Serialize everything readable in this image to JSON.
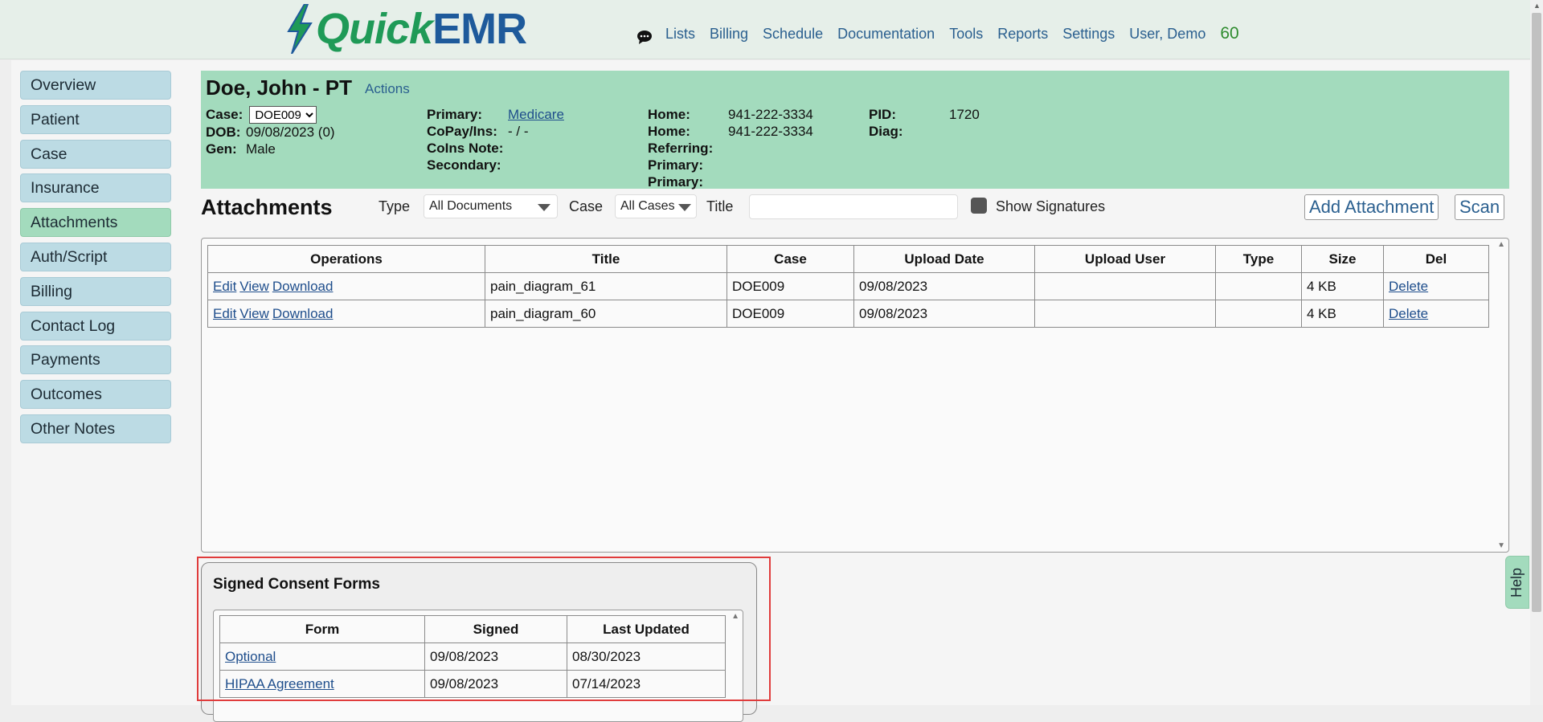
{
  "brand": {
    "quick": "Quick",
    "emr": "EMR"
  },
  "nav": {
    "items": [
      "Lists",
      "Billing",
      "Schedule",
      "Documentation",
      "Tools",
      "Reports",
      "Settings",
      "User, Demo"
    ],
    "count": "60"
  },
  "sidebar": {
    "items": [
      {
        "label": "Overview"
      },
      {
        "label": "Patient"
      },
      {
        "label": "Case"
      },
      {
        "label": "Insurance"
      },
      {
        "label": "Attachments",
        "active": true
      },
      {
        "label": "Auth/Script"
      },
      {
        "label": "Billing"
      },
      {
        "label": "Contact Log"
      },
      {
        "label": "Payments"
      },
      {
        "label": "Outcomes"
      },
      {
        "label": "Other Notes"
      }
    ]
  },
  "patient": {
    "name": "Doe, John - PT",
    "actions": "Actions",
    "case_label": "Case:",
    "case_value": "DOE009",
    "dob_label": "DOB:",
    "dob_value": "09/08/2023 (0)",
    "gen_label": "Gen:",
    "gen_value": "Male",
    "primary_label": "Primary:",
    "primary_value": "Medicare",
    "copay_label": "CoPay/Ins:",
    "copay_value": "- / -",
    "coins_label": "CoIns Note:",
    "secondary_label": "Secondary:",
    "home1_label": "Home:",
    "home1_value": "941-222-3334",
    "home2_label": "Home:",
    "home2_value": "941-222-3334",
    "referring_label": "Referring:",
    "primary2_label": "Primary:",
    "primary3_label": "Primary:",
    "pid_label": "PID:",
    "pid_value": "1720",
    "diag_label": "Diag:"
  },
  "attachments": {
    "title": "Attachments",
    "type_label": "Type",
    "type_value": "All Documents",
    "case_label": "Case",
    "case_value": "All Cases",
    "title_label": "Title",
    "title_value": "",
    "show_signatures": "Show Signatures",
    "add_button": "Add Attachment",
    "scan_button": "Scan",
    "columns": [
      "Operations",
      "Title",
      "Case",
      "Upload Date",
      "Upload User",
      "Type",
      "Size",
      "Del"
    ],
    "ops": {
      "edit": "Edit",
      "view": "View",
      "download": "Download",
      "delete": "Delete"
    },
    "rows": [
      {
        "title": "pain_diagram_61",
        "case": "DOE009",
        "date": "09/08/2023",
        "user": "",
        "type": "",
        "size": "4 KB"
      },
      {
        "title": "pain_diagram_60",
        "case": "DOE009",
        "date": "09/08/2023",
        "user": "",
        "type": "",
        "size": "4 KB"
      }
    ]
  },
  "consent": {
    "title": "Signed Consent Forms",
    "columns": [
      "Form",
      "Signed",
      "Last Updated"
    ],
    "rows": [
      {
        "form": "Optional",
        "signed": "09/08/2023",
        "updated": "08/30/2023"
      },
      {
        "form": "HIPAA Agreement",
        "signed": "09/08/2023",
        "updated": "07/14/2023"
      }
    ]
  },
  "help": "Help",
  "colors": {
    "accent_green": "#a3dbbd",
    "sidebar_blue": "#bcdbe4",
    "highlight_red": "#e03c3c"
  }
}
